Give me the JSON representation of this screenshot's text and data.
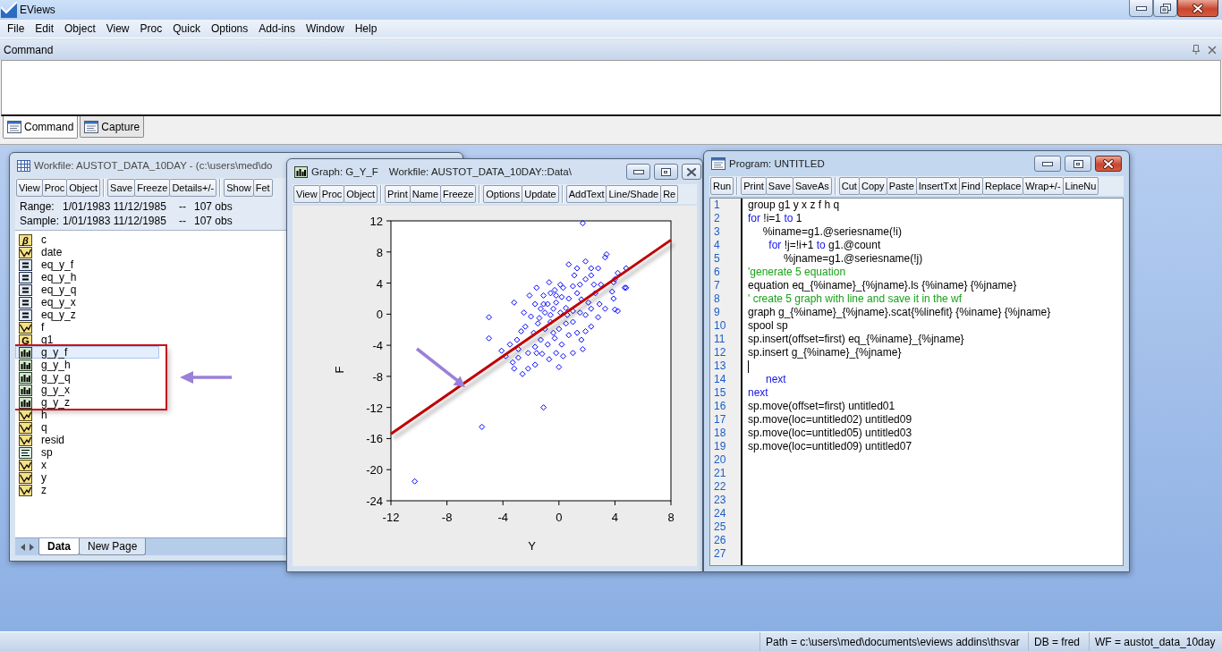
{
  "window": {
    "title": "EViews"
  },
  "menu": [
    "File",
    "Edit",
    "Object",
    "View",
    "Proc",
    "Quick",
    "Options",
    "Add-ins",
    "Window",
    "Help"
  ],
  "command_pane": {
    "title": "Command",
    "tabs": [
      {
        "label": "Command",
        "selected": true
      },
      {
        "label": "Capture",
        "selected": false
      }
    ]
  },
  "workfile_window": {
    "title": "Workfile: AUSTOT_DATA_10DAY - (c:\\users\\med\\do",
    "toolbar": [
      [
        "View",
        "Proc",
        "Object"
      ],
      [
        "Save",
        "Freeze",
        "Details+/-"
      ],
      [
        "Show",
        "Fet"
      ]
    ],
    "range": {
      "label": "Range:",
      "period": "1/01/1983 11/12/1985",
      "separator": "--",
      "count": "107 obs"
    },
    "sample": {
      "label": "Sample:",
      "period": "1/01/1983 11/12/1985",
      "separator": "--",
      "count": "107 obs"
    },
    "objects": [
      {
        "name": "c",
        "kind": "coef",
        "icon_text": "β",
        "selected": false,
        "outlined": false
      },
      {
        "name": "date",
        "kind": "series",
        "selected": false,
        "outlined": false
      },
      {
        "name": "eq_y_f",
        "kind": "equation",
        "selected": false,
        "outlined": false
      },
      {
        "name": "eq_y_h",
        "kind": "equation",
        "selected": false,
        "outlined": false
      },
      {
        "name": "eq_y_q",
        "kind": "equation",
        "selected": false,
        "outlined": false
      },
      {
        "name": "eq_y_x",
        "kind": "equation",
        "selected": false,
        "outlined": false
      },
      {
        "name": "eq_y_z",
        "kind": "equation",
        "selected": false,
        "outlined": false
      },
      {
        "name": "f",
        "kind": "series",
        "selected": false,
        "outlined": false
      },
      {
        "name": "g1",
        "kind": "group",
        "icon_text": "G",
        "selected": false,
        "outlined": false
      },
      {
        "name": "g_y_f",
        "kind": "graph",
        "selected": true,
        "outlined": true
      },
      {
        "name": "g_y_h",
        "kind": "graph",
        "selected": false,
        "outlined": true
      },
      {
        "name": "g_y_q",
        "kind": "graph",
        "selected": false,
        "outlined": true
      },
      {
        "name": "g_y_x",
        "kind": "graph",
        "selected": false,
        "outlined": true
      },
      {
        "name": "g_y_z",
        "kind": "graph",
        "selected": false,
        "outlined": true
      },
      {
        "name": "h",
        "kind": "series",
        "selected": false,
        "outlined": false
      },
      {
        "name": "q",
        "kind": "series",
        "selected": false,
        "outlined": false
      },
      {
        "name": "resid",
        "kind": "series",
        "selected": false,
        "outlined": false
      },
      {
        "name": "sp",
        "kind": "spool",
        "selected": false,
        "outlined": false
      },
      {
        "name": "x",
        "kind": "series",
        "selected": false,
        "outlined": false
      },
      {
        "name": "y",
        "kind": "series",
        "selected": false,
        "outlined": false
      },
      {
        "name": "z",
        "kind": "series",
        "selected": false,
        "outlined": false
      }
    ],
    "page_tabs": [
      {
        "label": "Data",
        "selected": true
      },
      {
        "label": "New Page",
        "selected": false
      }
    ]
  },
  "graph_window": {
    "title": "Graph: G_Y_F",
    "subtitle": "Workfile: AUSTOT_DATA_10DAY::Data\\",
    "active": false,
    "toolbar": [
      [
        "View",
        "Proc",
        "Object"
      ],
      [
        "Print",
        "Name",
        "Freeze"
      ],
      [
        "Options",
        "Update"
      ],
      [
        "AddText",
        "Line/Shade",
        "Re"
      ]
    ],
    "fit_line": true,
    "callout_arrow": true,
    "chart_data": {
      "type": "scatter",
      "xlabel": "Y",
      "ylabel": "F",
      "xlim": [
        -12,
        8
      ],
      "ylim": [
        -24,
        12
      ],
      "xticks": [
        -12,
        -8,
        -4,
        0,
        4,
        8
      ],
      "yticks": [
        12,
        8,
        4,
        0,
        -4,
        -8,
        -12,
        -16,
        -20,
        -24
      ],
      "x": [
        1.7,
        1.9,
        2.3,
        0.7,
        3.3,
        3.4,
        2.8,
        2.3,
        4.2,
        4.8,
        4.0,
        1.9,
        1.5,
        1.0,
        0.3,
        0.1,
        -0.7,
        -1.6,
        -1.1,
        -0.6,
        -0.2,
        0.2,
        0.7,
        1.3,
        1.6,
        2.1,
        2.6,
        2.9,
        3.3,
        3.8,
        3.9,
        4.7,
        4.0,
        -3.2,
        -2.1,
        -1.7,
        -1.3,
        -1.0,
        -0.8,
        -0.4,
        -0.2,
        0.1,
        0.5,
        1.0,
        1.5,
        1.9,
        2.3,
        2.8,
        1.0,
        0.5,
        0.0,
        -0.4,
        -1.0,
        -1.5,
        -2.0,
        -2.4,
        -2.7,
        -3.0,
        -3.5,
        -4.1,
        -3.8,
        -3.3,
        -2.9,
        -2.2,
        -1.7,
        -1.3,
        -0.8,
        -0.3,
        0.2,
        0.7,
        1.3,
        1.6,
        1.9,
        1.0,
        0.3,
        -0.2,
        -0.7,
        -1.2,
        -1.7,
        -2.2,
        -2.6,
        -3.2,
        0.0,
        -2.9,
        -5.0,
        -5.0,
        -5.5,
        -1.1,
        -10.3,
        4.8,
        4.2,
        -0.6,
        -1.8,
        -1.4,
        0.6,
        2.3,
        1.7,
        -1.6,
        3.9,
        2.5,
        1.1,
        -0.3,
        -2.5,
        -1.1,
        3.0,
        1.3,
        -0.6
      ],
      "series": [
        {
          "color": "#0000ff",
          "values": [
            11.7,
            6.8,
            5.9,
            6.4,
            7.3,
            7.7,
            5.9,
            5.0,
            5.3,
            5.9,
            4.5,
            4.5,
            3.8,
            3.6,
            3.4,
            3.8,
            4.1,
            3.4,
            2.4,
            2.7,
            2.4,
            2.2,
            2.0,
            2.7,
            1.9,
            1.5,
            2.7,
            1.3,
            0.7,
            2.9,
            2.0,
            3.4,
            0.6,
            1.5,
            2.4,
            1.3,
            0.7,
            0.2,
            1.3,
            0.7,
            1.5,
            0.2,
            0.8,
            0.4,
            0.2,
            -0.1,
            0.7,
            -0.4,
            -1.0,
            -1.2,
            -1.9,
            -2.4,
            -1.9,
            -1.2,
            -0.3,
            -1.6,
            -2.2,
            -3.3,
            -3.9,
            -4.7,
            -5.4,
            -6.2,
            -5.6,
            -5.0,
            -4.2,
            -3.3,
            -3.9,
            -3.1,
            -3.9,
            -2.7,
            -2.4,
            -3.3,
            -2.2,
            -5.0,
            -5.4,
            -5.0,
            -5.8,
            -5.1,
            -6.5,
            -7.0,
            -7.7,
            -7.0,
            -6.8,
            -4.5,
            -0.4,
            -3.1,
            -14.5,
            -12.0,
            -21.5,
            3.4,
            0.4,
            -1.0,
            -2.4,
            -0.5,
            -0.1,
            -1.6,
            -4.5,
            -5.0,
            4.1,
            3.8,
            5.0,
            3.1,
            0.2,
            1.3,
            3.8,
            5.9,
            -0.1
          ]
        }
      ]
    }
  },
  "program_window": {
    "title": "Program: UNTITLED",
    "active": true,
    "toolbar": [
      [
        "Run"
      ],
      [
        "Print",
        "Save",
        "SaveAs"
      ],
      [
        "Cut",
        "Copy",
        "Paste",
        "InsertTxt",
        "Find",
        "Replace",
        "Wrap+/-",
        "LineNu"
      ]
    ],
    "line_numbers": [
      "1",
      "2",
      "3",
      "4",
      "5",
      "6",
      "7",
      "8",
      "9",
      "10",
      "11",
      "12",
      "13",
      "14",
      "15",
      "16",
      "17",
      "18",
      "19",
      "20",
      "21",
      "22",
      "23",
      "24",
      "25",
      "26",
      "27"
    ],
    "lines": [
      {
        "cursor": false,
        "segments": [
          {
            "text": "group g1 y x z f h q",
            "kind": "plain"
          }
        ]
      },
      {
        "cursor": false,
        "segments": [
          {
            "text": "for",
            "kind": "keyword"
          },
          {
            "text": " !i=1 ",
            "kind": "plain"
          },
          {
            "text": "to",
            "kind": "keyword"
          },
          {
            "text": " 1",
            "kind": "plain"
          }
        ]
      },
      {
        "cursor": false,
        "segments": [
          {
            "text": "     %iname=g1.@seriesname(!i)",
            "kind": "plain"
          }
        ]
      },
      {
        "cursor": false,
        "segments": [
          {
            "text": "       for",
            "kind": "keyword"
          },
          {
            "text": " !j=!i+1 ",
            "kind": "plain"
          },
          {
            "text": "to",
            "kind": "keyword"
          },
          {
            "text": " g1.@count",
            "kind": "plain"
          }
        ]
      },
      {
        "cursor": false,
        "segments": [
          {
            "text": "            %jname=g1.@seriesname(!j)",
            "kind": "plain"
          }
        ]
      },
      {
        "cursor": false,
        "segments": [
          {
            "text": "'generate 5 equation",
            "kind": "comment"
          }
        ]
      },
      {
        "cursor": false,
        "segments": [
          {
            "text": "equation eq_{%iname}_{%jname}.ls {%iname} {%jname}",
            "kind": "plain"
          }
        ]
      },
      {
        "cursor": false,
        "segments": [
          {
            "text": "' create 5 graph with line and save it in the wf",
            "kind": "comment"
          }
        ]
      },
      {
        "cursor": false,
        "segments": [
          {
            "text": "graph g_{%iname}_{%jname}.scat{%linefit} {%iname} {%jname}",
            "kind": "plain"
          }
        ]
      },
      {
        "cursor": false,
        "segments": [
          {
            "text": "spool sp",
            "kind": "plain"
          }
        ]
      },
      {
        "cursor": false,
        "segments": [
          {
            "text": "sp.insert(offset=first) eq_{%iname}_{%jname}",
            "kind": "plain"
          }
        ]
      },
      {
        "cursor": false,
        "segments": [
          {
            "text": "sp.insert g_{%iname}_{%jname}",
            "kind": "plain"
          }
        ]
      },
      {
        "cursor": true
      },
      {
        "cursor": false,
        "segments": [
          {
            "text": "      next",
            "kind": "keyword"
          }
        ]
      },
      {
        "cursor": false,
        "segments": [
          {
            "text": "next",
            "kind": "keyword"
          }
        ]
      },
      {
        "cursor": false,
        "segments": [
          {
            "text": "sp.move(offset=first) untitled01",
            "kind": "plain"
          }
        ]
      },
      {
        "cursor": false,
        "segments": [
          {
            "text": "sp.move(loc=untitled02) untitled09",
            "kind": "plain"
          }
        ]
      },
      {
        "cursor": false,
        "segments": [
          {
            "text": "sp.move(loc=untitled05) untitled03",
            "kind": "plain"
          }
        ]
      },
      {
        "cursor": false,
        "segments": [
          {
            "text": "sp.move(loc=untitled09) untitled07",
            "kind": "plain"
          }
        ]
      }
    ]
  },
  "status_bar": [
    "Path = c:\\users\\med\\documents\\eviews addins\\thsvar",
    "DB = fred",
    "WF = austot_data_10day"
  ]
}
